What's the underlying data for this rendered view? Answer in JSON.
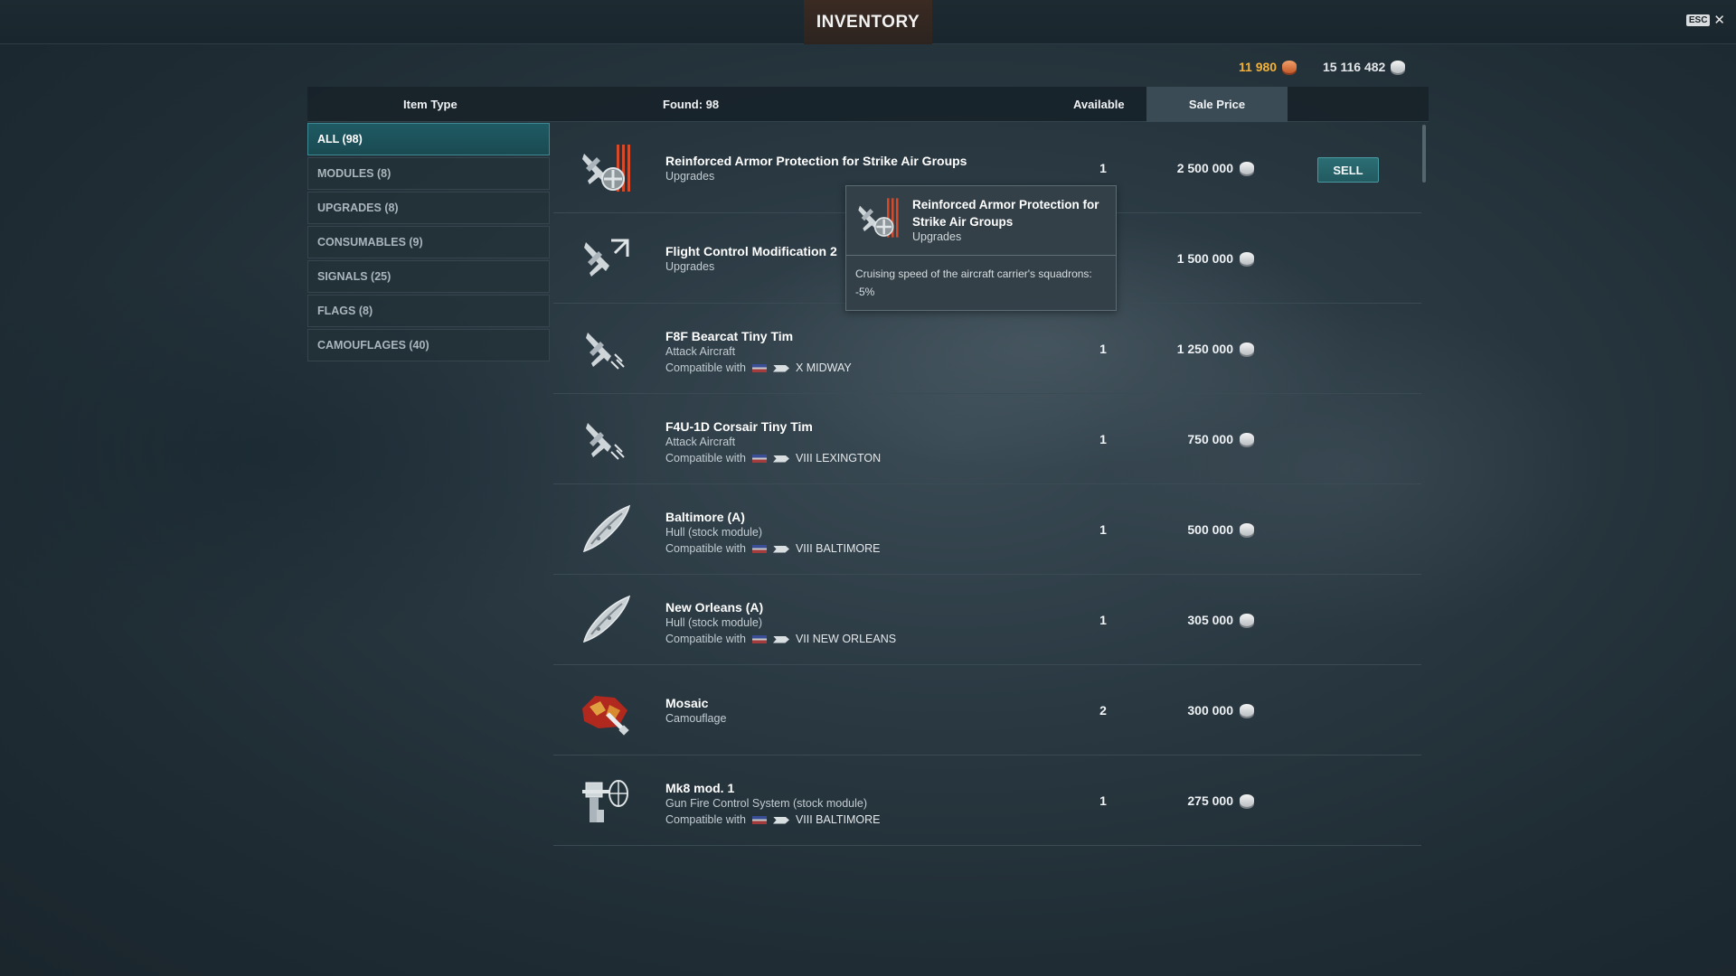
{
  "window": {
    "title": "INVENTORY",
    "esc_label": "ESC",
    "close_glyph": "✕"
  },
  "currency": {
    "doubloons": "11 980",
    "credits": "15 116 482"
  },
  "header": {
    "item_type": "Item Type",
    "found": "Found: 98",
    "available": "Available",
    "sale_price": "Sale Price"
  },
  "categories": [
    {
      "label": "ALL (98)",
      "active": true
    },
    {
      "label": "MODULES (8)"
    },
    {
      "label": "UPGRADES (8)"
    },
    {
      "label": "CONSUMABLES (9)"
    },
    {
      "label": "SIGNALS (25)"
    },
    {
      "label": "FLAGS (8)"
    },
    {
      "label": "CAMOUFLAGES (40)"
    }
  ],
  "items": [
    {
      "name": "Reinforced Armor Protection for Strike Air Groups",
      "type": "Upgrades",
      "available": "1",
      "price": "2 500 000",
      "icon": "armor-upgrade-icon"
    },
    {
      "name": "Flight Control Modification 2",
      "type": "Upgrades",
      "available": "",
      "price": "1 500 000",
      "icon": "flight-control-icon"
    },
    {
      "name": "F8F Bearcat Tiny Tim",
      "type": "Attack Aircraft",
      "compat_label": "Compatible with",
      "compat_ship": "X MIDWAY",
      "available": "1",
      "price": "1 250 000",
      "icon": "attack-aircraft-icon"
    },
    {
      "name": "F4U-1D Corsair Tiny Tim",
      "type": "Attack Aircraft",
      "compat_label": "Compatible with",
      "compat_ship": "VIII LEXINGTON",
      "available": "1",
      "price": "750 000",
      "icon": "attack-aircraft-icon"
    },
    {
      "name": "Baltimore (A)",
      "type": "Hull (stock module)",
      "compat_label": "Compatible with",
      "compat_ship": "VIII BALTIMORE",
      "available": "1",
      "price": "500 000",
      "icon": "hull-icon"
    },
    {
      "name": "New Orleans (A)",
      "type": "Hull (stock module)",
      "compat_label": "Compatible with",
      "compat_ship": "VII NEW ORLEANS",
      "available": "1",
      "price": "305 000",
      "icon": "hull-icon"
    },
    {
      "name": "Mosaic",
      "type": "Camouflage",
      "available": "2",
      "price": "300 000",
      "icon": "camouflage-icon"
    },
    {
      "name": "Mk8 mod. 1",
      "type": "Gun Fire Control System (stock module)",
      "compat_label": "Compatible with",
      "compat_ship": "VIII BALTIMORE",
      "available": "1",
      "price": "275 000",
      "icon": "fire-control-icon"
    }
  ],
  "sell_button": "SELL",
  "tooltip": {
    "name": "Reinforced Armor Protection for Strike Air Groups",
    "type": "Upgrades",
    "description": "Cruising speed of the aircraft carrier's squadrons: -5%"
  },
  "colors": {
    "accent_teal": "#2b6e74",
    "doubloon_gold": "#f3b23b",
    "background": "#2a3942"
  }
}
